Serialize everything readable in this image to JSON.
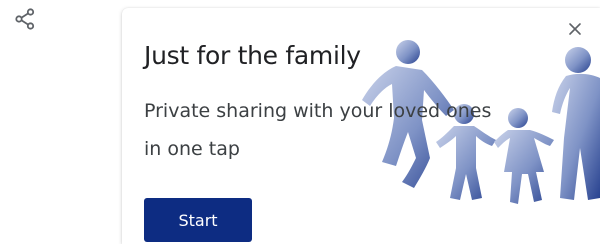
{
  "share": {
    "icon": "share-icon"
  },
  "promo_card": {
    "title": "Just for the family",
    "description": "Private sharing with your loved ones in one tap",
    "start_label": "Start",
    "close_icon": "close-icon",
    "illustration": "family-silhouette-illustration"
  },
  "colors": {
    "button_bg": "#0d2c82",
    "illustration_dark": "#27418f",
    "illustration_light": "#c9d2ea"
  }
}
